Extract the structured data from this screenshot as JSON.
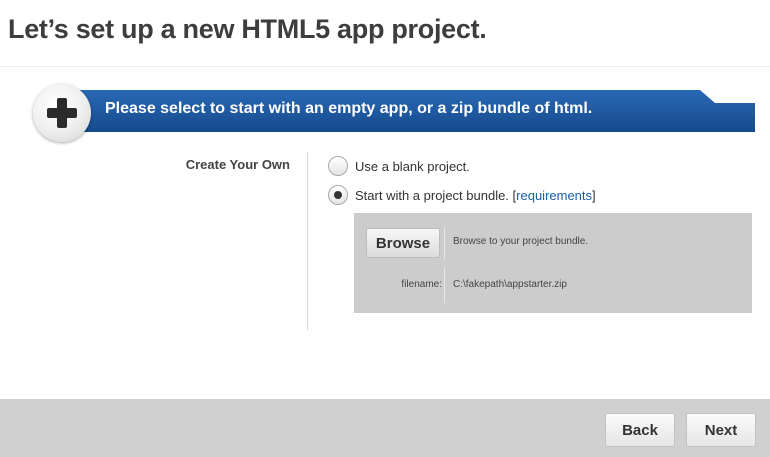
{
  "page": {
    "title": "Let’s set up a new HTML5 app project."
  },
  "banner": {
    "text": "Please select to start with an empty app, or a zip bundle of html.",
    "icon": "plus-icon",
    "color": "#1b56a0"
  },
  "form": {
    "label": "Create Your Own",
    "options": [
      {
        "label": "Use a blank project.",
        "checked": false
      },
      {
        "label": "Start with a project bundle. [",
        "link": "requirements",
        "suffix": "]",
        "checked": true
      }
    ]
  },
  "upload": {
    "browse_label": "Browse",
    "browse_hint": "Browse to your project bundle.",
    "filename_label": "filename:",
    "filename_value": "C:\\fakepath\\appstarter.zip"
  },
  "footer": {
    "back_label": "Back",
    "next_label": "Next"
  }
}
